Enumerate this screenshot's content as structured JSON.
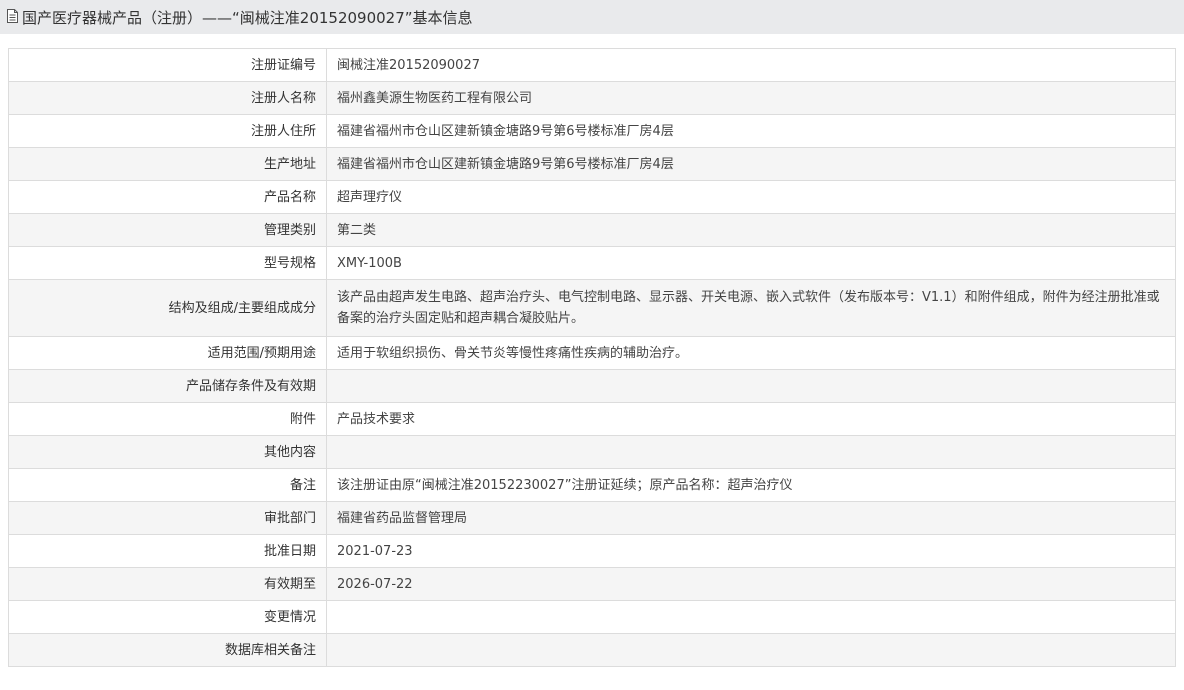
{
  "header": {
    "title": "国产医疗器械产品（注册）——“闽械注准20152090027”基本信息",
    "icon": "document-icon"
  },
  "rows": [
    {
      "label": "注册证编号",
      "value": "闽械注准20152090027"
    },
    {
      "label": "注册人名称",
      "value": "福州鑫美源生物医药工程有限公司"
    },
    {
      "label": "注册人住所",
      "value": "福建省福州市仓山区建新镇金塘路9号第6号楼标准厂房4层"
    },
    {
      "label": "生产地址",
      "value": "福建省福州市仓山区建新镇金塘路9号第6号楼标准厂房4层"
    },
    {
      "label": "产品名称",
      "value": "超声理疗仪"
    },
    {
      "label": "管理类别",
      "value": "第二类"
    },
    {
      "label": "型号规格",
      "value": "XMY-100B"
    },
    {
      "label": "结构及组成/主要组成成分",
      "value": "该产品由超声发生电路、超声治疗头、电气控制电路、显示器、开关电源、嵌入式软件（发布版本号：V1.1）和附件组成，附件为经注册批准或备案的治疗头固定贴和超声耦合凝胶贴片。"
    },
    {
      "label": "适用范围/预期用途",
      "value": "适用于软组织损伤、骨关节炎等慢性疼痛性疾病的辅助治疗。"
    },
    {
      "label": "产品储存条件及有效期",
      "value": ""
    },
    {
      "label": "附件",
      "value": "产品技术要求"
    },
    {
      "label": "其他内容",
      "value": ""
    },
    {
      "label": "备注",
      "value": "该注册证由原“闽械注准20152230027”注册证延续；原产品名称：超声治疗仪"
    },
    {
      "label": "审批部门",
      "value": "福建省药品监督管理局"
    },
    {
      "label": "批准日期",
      "value": "2021-07-23"
    },
    {
      "label": "有效期至",
      "value": "2026-07-22"
    },
    {
      "label": "变更情况",
      "value": ""
    },
    {
      "label": "数据库相关备注",
      "value": ""
    }
  ]
}
